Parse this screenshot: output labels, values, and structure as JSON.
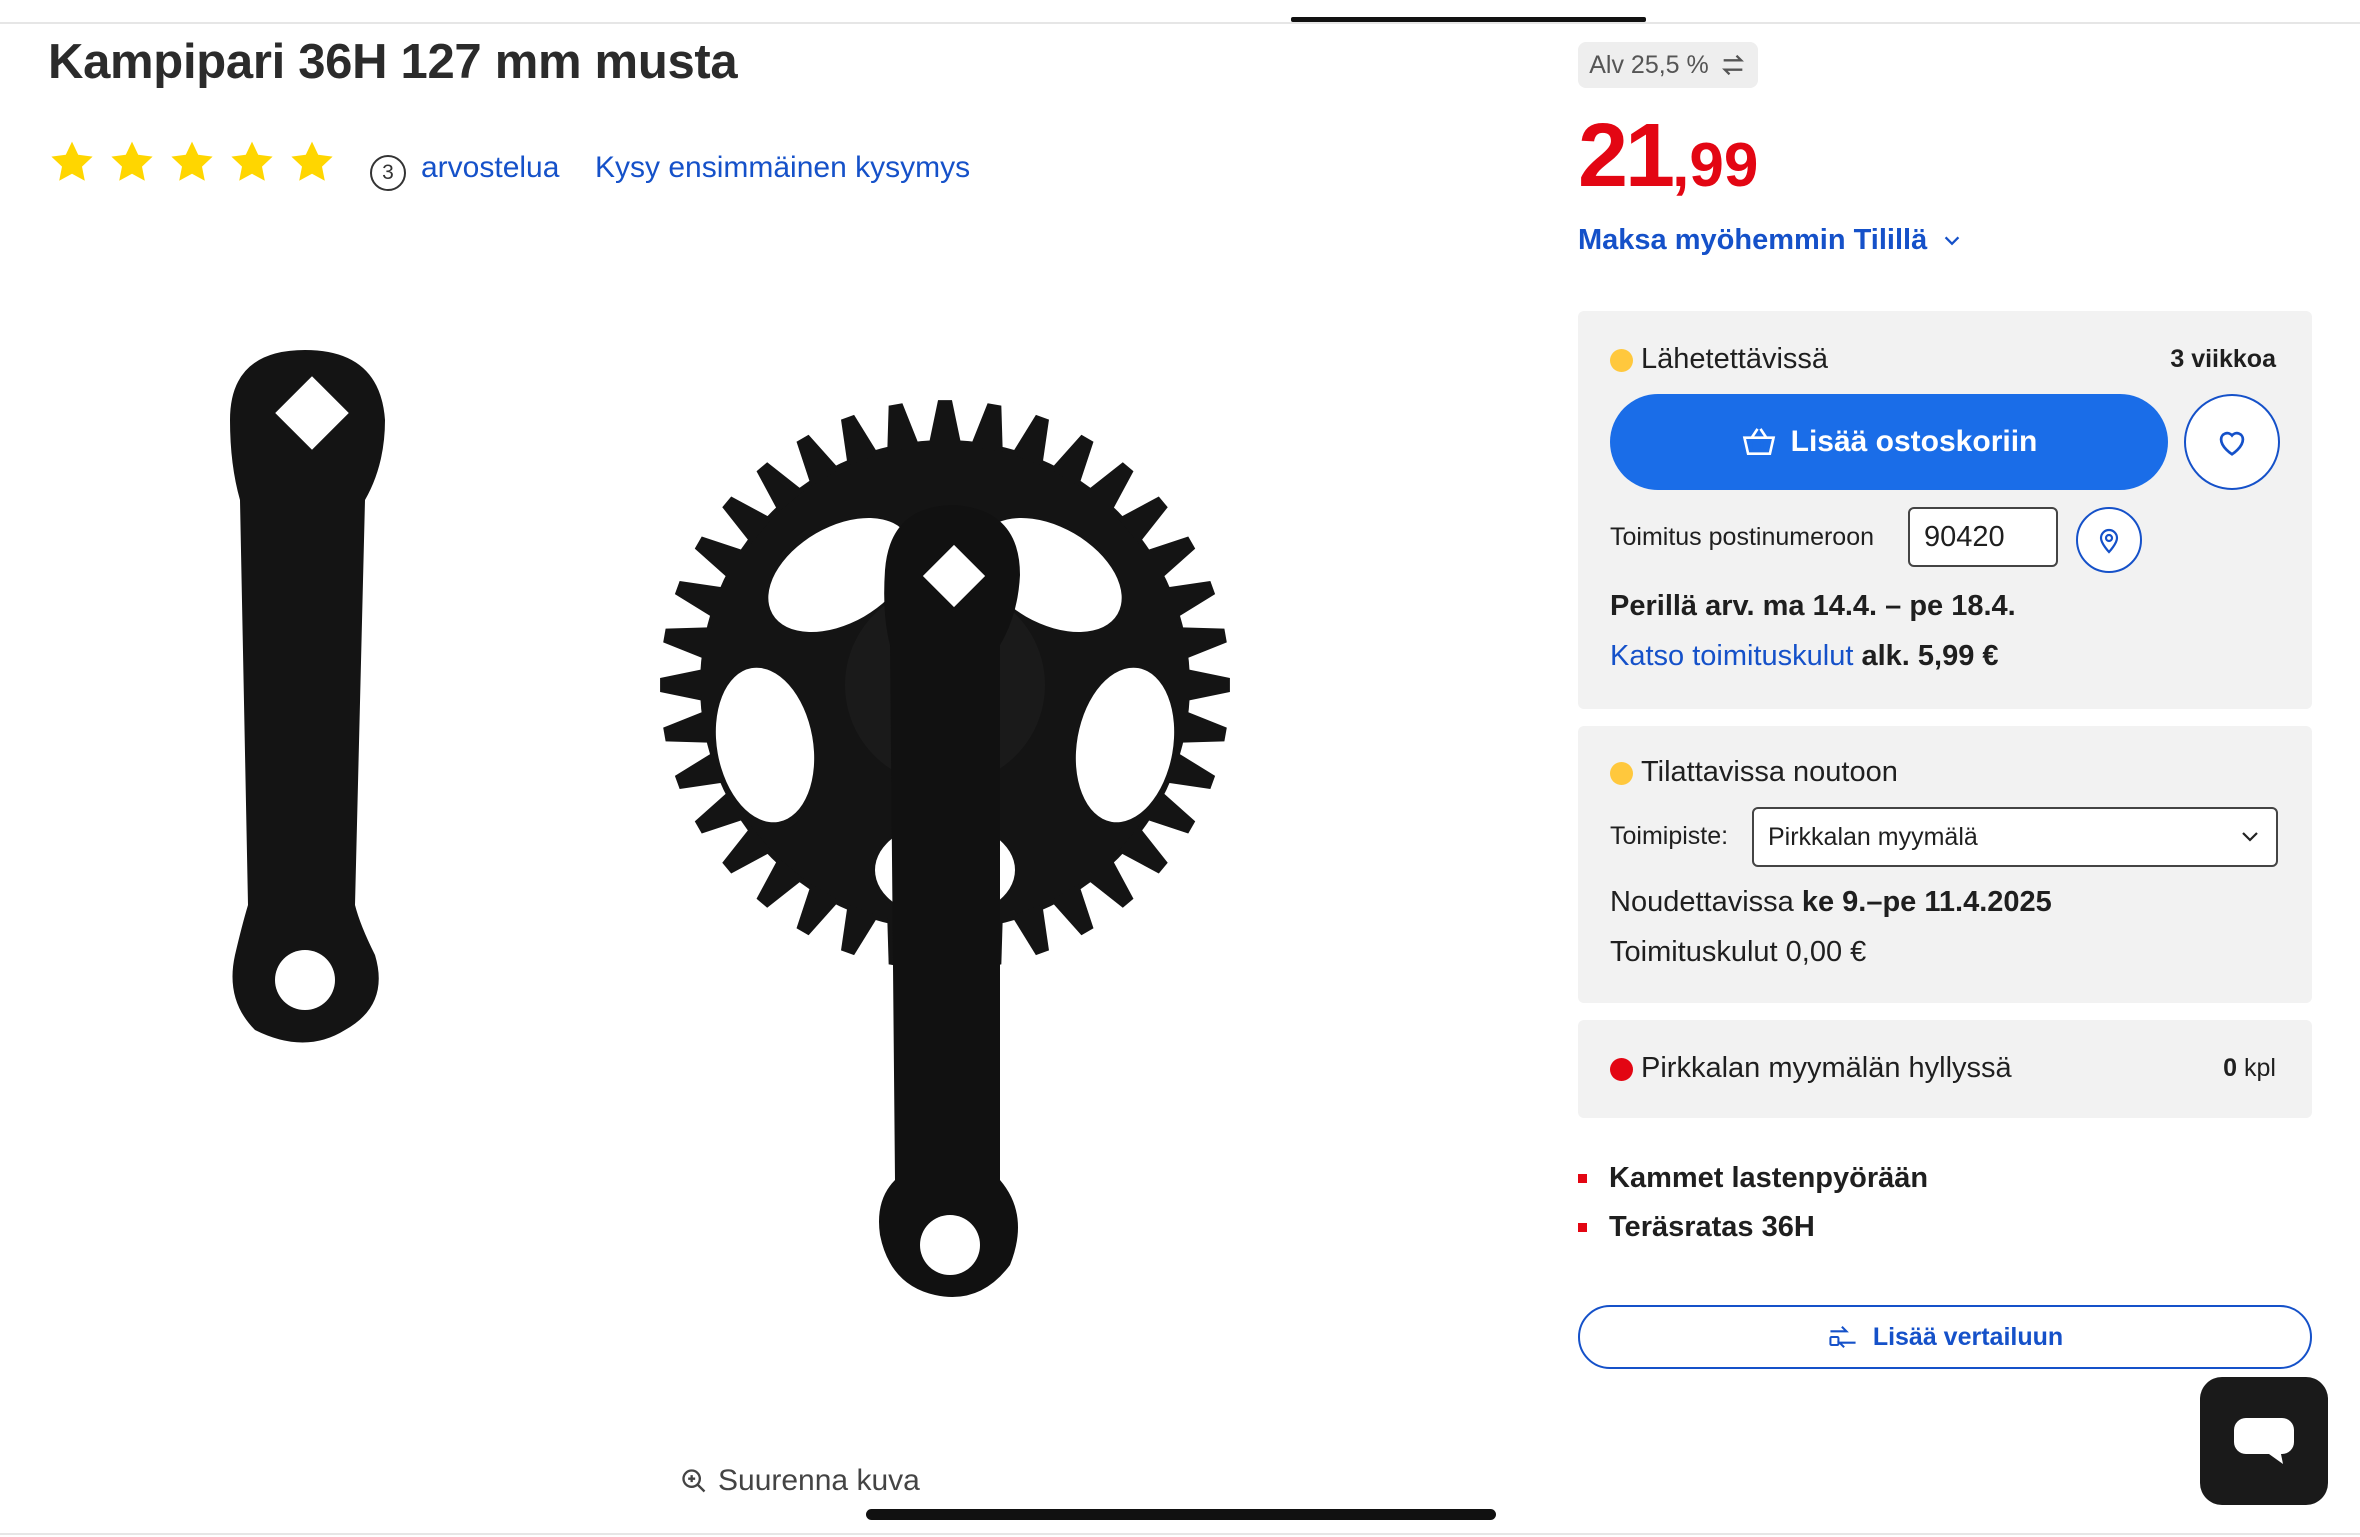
{
  "product": {
    "title": "Kampipari 36H 127 mm musta",
    "rating_stars": 5,
    "review_count": "3",
    "reviews_label": "arvostelua",
    "ask_question": "Kysy ensimmäinen kysymys",
    "zoom_label": "Suurenna kuva"
  },
  "pricing": {
    "vat_label": "Alv 25,5 %",
    "price_integer": "21",
    "price_decimals": ",99",
    "price_color": "#e30613",
    "pay_later": "Maksa myöhemmin Tilillä"
  },
  "shipping": {
    "status": "Lähetettävissä",
    "lead_time": "3 viikkoa",
    "add_to_cart": "Lisää ostoskoriin",
    "postal_label": "Toimitus postinumeroon",
    "postal_value": "90420",
    "delivery_estimate": "Perillä arv. ma 14.4. – pe 18.4.",
    "costs_link": "Katso toimituskulut",
    "costs_from": "alk. 5,99 €"
  },
  "pickup": {
    "status": "Tilattavissa noutoon",
    "store_label": "Toimipiste:",
    "store_selected": "Pirkkalan myymälä",
    "available_prefix": "Noudettavissa",
    "available_dates": "ke 9.–pe 11.4.2025",
    "shipping_cost": "Toimituskulut 0,00 €"
  },
  "stock": {
    "shelf_label": "Pirkkalan myymälän hyllyssä",
    "shelf_count": "0",
    "shelf_unit": "kpl"
  },
  "features": [
    "Kammet lastenpyörään",
    "Teräsratas 36H"
  ],
  "compare_label": "Lisää vertailuun",
  "colors": {
    "link": "#1551c9",
    "primary_button": "#1a6de8",
    "star": "#ffd600",
    "status_yellow": "#ffc83d",
    "status_red": "#e30613"
  },
  "icons": [
    "star-icon",
    "zoom-in-icon",
    "swap-icon",
    "chevron-down-icon",
    "basket-icon",
    "heart-icon",
    "location-pin-icon",
    "compare-icon",
    "chat-icon"
  ]
}
